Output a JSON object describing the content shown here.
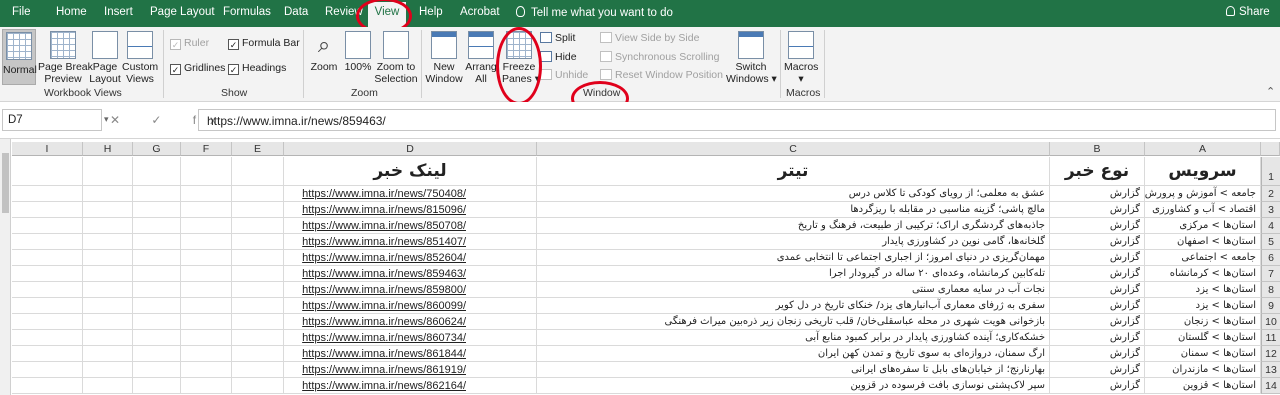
{
  "tabs": [
    "File",
    "Home",
    "Insert",
    "Page Layout",
    "Formulas",
    "Data",
    "Review",
    "View",
    "Help",
    "Acrobat"
  ],
  "active_tab": "View",
  "tell_me": "Tell me what you want to do",
  "share": "Share",
  "ribbon": {
    "workbook_views": {
      "label": "Workbook Views",
      "normal": "Normal",
      "page_break_1": "Page Break",
      "page_break_2": "Preview",
      "page_layout_1": "Page",
      "page_layout_2": "Layout",
      "custom_1": "Custom",
      "custom_2": "Views"
    },
    "show": {
      "label": "Show",
      "ruler": "Ruler",
      "formula_bar": "Formula Bar",
      "gridlines": "Gridlines",
      "headings": "Headings"
    },
    "zoom": {
      "label": "Zoom",
      "zoom": "Zoom",
      "hundred": "100%",
      "zoom_sel_1": "Zoom to",
      "zoom_sel_2": "Selection"
    },
    "window": {
      "label": "Window",
      "new_1": "New",
      "new_2": "Window",
      "arrange_1": "Arrang",
      "arrange_2": "All",
      "freeze_1": "Freeze",
      "freeze_2": "Panes",
      "split": "Split",
      "hide": "Hide",
      "unhide": "Unhide",
      "side_by_side": "View Side by Side",
      "sync_scroll": "Synchronous Scrolling",
      "reset_pos": "Reset Window Position",
      "switch_1": "Switch",
      "switch_2": "Windows"
    },
    "macros": {
      "label": "Macros",
      "macros": "Macros"
    }
  },
  "formula_bar": {
    "name_box": "D7",
    "icons": "✕ ✓ fx",
    "value": "https://www.imna.ir/news/859463/"
  },
  "columns": [
    "I",
    "H",
    "G",
    "F",
    "E",
    "D",
    "C",
    "B",
    "A"
  ],
  "rows": [
    {
      "n": "1",
      "a": "سرویس",
      "b": "نوع خبر",
      "c": "تیتر",
      "d": "لینک خبر"
    },
    {
      "n": "2",
      "a": "جامعه > آموزش و پرورش",
      "b": "گزارش",
      "c": "عشق به معلمی؛ از رویای کودکی تا کلاس درس",
      "d": "https://www.imna.ir/news/750408/"
    },
    {
      "n": "3",
      "a": "اقتصاد > آب و کشاورزی",
      "b": "گزارش",
      "c": "مالچ پاشی؛ گزینه مناسبی در مقابله با ریزگردها",
      "d": "https://www.imna.ir/news/815096/"
    },
    {
      "n": "4",
      "a": "استان‌ها > مرکزی",
      "b": "گزارش",
      "c": "جاذبه‌های گردشگری اراک؛ ترکیبی از طبیعت، فرهنگ و تاریخ",
      "d": "https://www.imna.ir/news/850708/"
    },
    {
      "n": "5",
      "a": "استان‌ها > اصفهان",
      "b": "گزارش",
      "c": "گلخانه‌ها، گامی نوین در کشاورزی پایدار",
      "d": "https://www.imna.ir/news/851407/"
    },
    {
      "n": "6",
      "a": "جامعه > اجتماعی",
      "b": "گزارش",
      "c": "مهمان‌گریزی در دنیای امروز؛ از اجباری اجتماعی تا انتخابی عمدی",
      "d": "https://www.imna.ir/news/852604/"
    },
    {
      "n": "7",
      "a": "استان‌ها > کرمانشاه",
      "b": "گزارش",
      "c": "تله‌کابین کرمانشاه، وعده‌ای ۲۰ ساله در گیرودار اجرا",
      "d": "https://www.imna.ir/news/859463/"
    },
    {
      "n": "8",
      "a": "استان‌ها > یزد",
      "b": "گزارش",
      "c": "نجات آب در سایه معماری سنتی",
      "d": "https://www.imna.ir/news/859800/"
    },
    {
      "n": "9",
      "a": "استان‌ها > یزد",
      "b": "گزارش",
      "c": "سفری به ژرفای معماری آب‌انبارهای یزد/ خنکای تاریخ در دل کویر",
      "d": "https://www.imna.ir/news/860099/"
    },
    {
      "n": "10",
      "a": "استان‌ها > زنجان",
      "b": "گزارش",
      "c": "بازخوانی هویت شهری در محله عباسقلی‌خان/ قلب تاریخی زنجان زیر ذره‌بین میراث فرهنگی",
      "d": "https://www.imna.ir/news/860624/"
    },
    {
      "n": "11",
      "a": "استان‌ها > گلستان",
      "b": "گزارش",
      "c": "خشکه‌کاری؛ آینده کشاورزی پایدار در برابر کمبود منابع آبی",
      "d": "https://www.imna.ir/news/860734/"
    },
    {
      "n": "12",
      "a": "استان‌ها > سمنان",
      "b": "گزارش",
      "c": "ارگ سمنان، دروازه‌ای به سوی تاریخ و تمدن کهن ایران",
      "d": "https://www.imna.ir/news/861844/"
    },
    {
      "n": "13",
      "a": "استان‌ها > مازندران",
      "b": "گزارش",
      "c": "بهارنارنج؛ از خیابان‌های بابل تا سفره‌های ایرانی",
      "d": "https://www.imna.ir/news/861919/"
    },
    {
      "n": "14",
      "a": "استان‌ها > قزوین",
      "b": "گزارش",
      "c": "سپر لاک‌پشتی نوسازی بافت فرسوده در قزوین",
      "d": "https://www.imna.ir/news/862164/"
    }
  ]
}
